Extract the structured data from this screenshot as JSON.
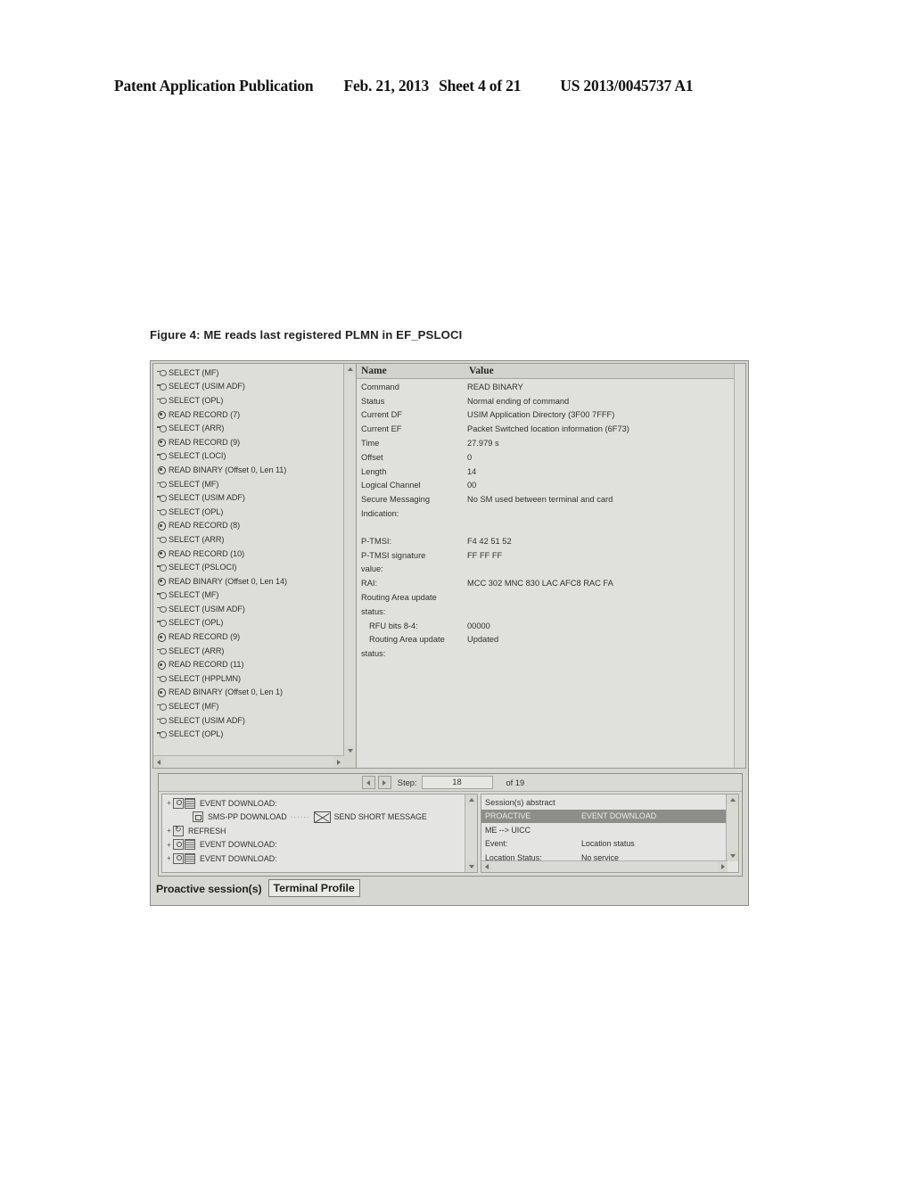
{
  "patent_header": {
    "publication": "Patent Application Publication",
    "date": "Feb. 21, 2013",
    "sheet": "Sheet 4 of 21",
    "number": "US 2013/0045737 A1"
  },
  "figure": {
    "caption": "Figure 4: ME reads last registered PLMN in EF_PSLOCI"
  },
  "tree_pane": {
    "items": [
      {
        "icon": "select-icon",
        "label": "SELECT (MF)"
      },
      {
        "icon": "select-icon",
        "label": "SELECT (USIM ADF)"
      },
      {
        "icon": "select-icon",
        "label": "SELECT (OPL)"
      },
      {
        "icon": "read-icon",
        "label": "READ RECORD (7)"
      },
      {
        "icon": "select-icon",
        "label": "SELECT (ARR)"
      },
      {
        "icon": "read-icon",
        "label": "READ RECORD (9)"
      },
      {
        "icon": "select-icon",
        "label": "SELECT (LOCI)"
      },
      {
        "icon": "read-icon",
        "label": "READ BINARY (Offset 0, Len 11)"
      },
      {
        "icon": "select-icon",
        "label": "SELECT (MF)"
      },
      {
        "icon": "select-icon",
        "label": "SELECT (USIM ADF)"
      },
      {
        "icon": "select-icon",
        "label": "SELECT (OPL)"
      },
      {
        "icon": "read-icon",
        "label": "READ RECORD (8)"
      },
      {
        "icon": "select-icon",
        "label": "SELECT (ARR)"
      },
      {
        "icon": "read-icon",
        "label": "READ RECORD (10)"
      },
      {
        "icon": "select-icon",
        "label": "SELECT (PSLOCI)"
      },
      {
        "icon": "read-icon",
        "label": "READ BINARY (Offset 0, Len 14)"
      },
      {
        "icon": "select-icon",
        "label": "SELECT (MF)"
      },
      {
        "icon": "select-icon",
        "label": "SELECT (USIM ADF)"
      },
      {
        "icon": "select-icon",
        "label": "SELECT (OPL)"
      },
      {
        "icon": "read-icon",
        "label": "READ RECORD (9)"
      },
      {
        "icon": "select-icon",
        "label": "SELECT (ARR)"
      },
      {
        "icon": "read-icon",
        "label": "READ RECORD (11)"
      },
      {
        "icon": "select-icon",
        "label": "SELECT (HPPLMN)"
      },
      {
        "icon": "read-icon",
        "label": "READ BINARY (Offset 0, Len 1)"
      },
      {
        "icon": "select-icon",
        "label": "SELECT (MF)"
      },
      {
        "icon": "select-icon",
        "label": "SELECT (USIM ADF)"
      },
      {
        "icon": "select-icon",
        "label": "SELECT (OPL)"
      }
    ]
  },
  "detail_pane": {
    "columns": {
      "name": "Name",
      "value": "Value"
    },
    "rows": [
      {
        "name": "Command",
        "value": "READ BINARY"
      },
      {
        "name": "Status",
        "value": "Normal ending of command"
      },
      {
        "name": "Current DF",
        "value": "USIM Application Directory (3F00 7FFF)"
      },
      {
        "name": "Current EF",
        "value": "Packet Switched location information (6F73)"
      },
      {
        "name": "Time",
        "value": "27.979 s"
      },
      {
        "name": "Offset",
        "value": "0"
      },
      {
        "name": "Length",
        "value": "14"
      },
      {
        "name": "Logical Channel",
        "value": "00"
      },
      {
        "name": "Secure Messaging",
        "value": "No SM used between terminal and card"
      },
      {
        "name": "Indication:",
        "value": ""
      }
    ],
    "rows2": [
      {
        "name": "P-TMSI:",
        "value": "F4 42 51 52"
      },
      {
        "name": "P-TMSI signature",
        "value": "FF FF FF"
      },
      {
        "name": "value:",
        "value": ""
      },
      {
        "name": "RAI:",
        "value": "MCC 302   MNC 830   LAC AFC8   RAC FA"
      },
      {
        "name": "Routing Area update",
        "value": ""
      },
      {
        "name": "status:",
        "value": ""
      },
      {
        "name": "RFU bits 8-4:",
        "value": "00000",
        "indent": true
      },
      {
        "name": "Routing Area update",
        "value": "Updated",
        "indent": true
      },
      {
        "name": "status:",
        "value": ""
      }
    ]
  },
  "step_bar": {
    "prev_icon": "step-prev-icon",
    "next_icon": "step-next-icon",
    "label": "Step:",
    "current": "18",
    "total": "of 19"
  },
  "event_pane": {
    "rows": [
      {
        "expander": "+",
        "icons": [
          "bulb-icon",
          "grid-icon"
        ],
        "label": "EVENT DOWNLOAD:",
        "indented": false
      },
      {
        "expander": "",
        "icons": [
          "sms-icon"
        ],
        "label": "SMS-PP DOWNLOAD",
        "indented": true,
        "link_label": "SEND SHORT MESSAGE",
        "link_icon": "envelope-icon"
      },
      {
        "expander": "+",
        "icons": [
          "refresh-icon"
        ],
        "label": "REFRESH",
        "indented": false
      },
      {
        "expander": "+",
        "icons": [
          "bulb-icon",
          "grid-icon"
        ],
        "label": "EVENT DOWNLOAD:",
        "indented": false
      },
      {
        "expander": "+",
        "icons": [
          "bulb-icon",
          "grid-icon"
        ],
        "label": "EVENT DOWNLOAD:",
        "indented": false
      }
    ]
  },
  "session_pane": {
    "title": "Session(s) abstract",
    "selected_row": {
      "name": "PROACTIVE",
      "value": "EVENT DOWNLOAD"
    },
    "rows": [
      {
        "name": "ME --> UICC",
        "value": ""
      },
      {
        "name": "Event:",
        "value": "Location status"
      },
      {
        "name": "Location Status:",
        "value": "No service"
      },
      {
        "name": "...",
        "value": "..."
      }
    ]
  },
  "tabs": [
    {
      "label": "Proactive session(s)",
      "active": false
    },
    {
      "label": "Terminal Profile",
      "active": true
    }
  ]
}
